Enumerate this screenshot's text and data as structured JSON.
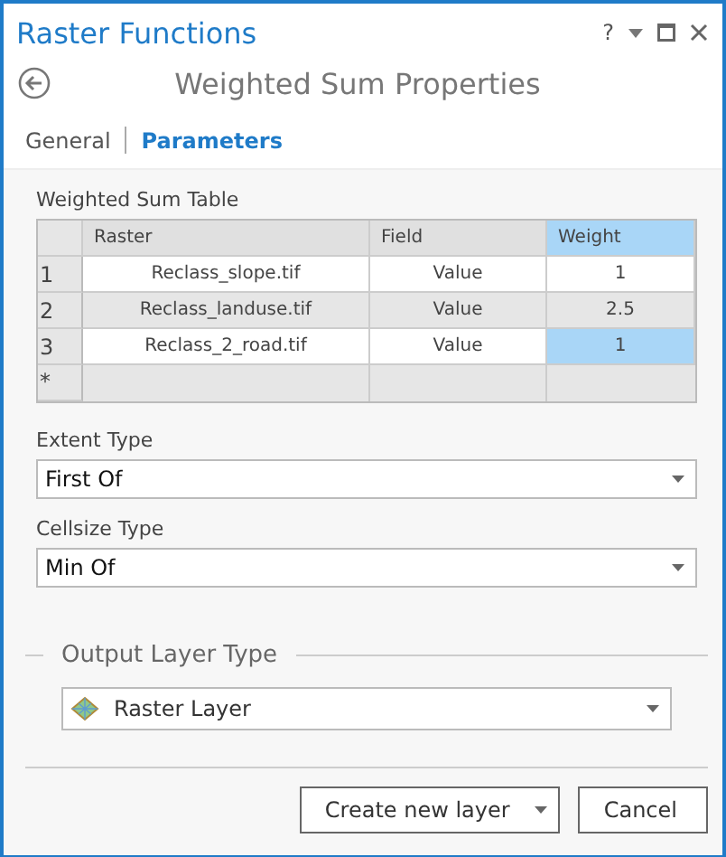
{
  "window": {
    "title": "Raster Functions",
    "help": "?"
  },
  "header": {
    "title": "Weighted Sum Properties"
  },
  "tabs": [
    {
      "label": "General",
      "selected": false
    },
    {
      "label": "Parameters",
      "selected": true
    }
  ],
  "table": {
    "title": "Weighted Sum Table",
    "columns": [
      {
        "label": "Raster",
        "selected": false
      },
      {
        "label": "Field",
        "selected": false
      },
      {
        "label": "Weight",
        "selected": true
      }
    ],
    "rows": [
      {
        "number": "1",
        "raster": "Reclass_slope.tif",
        "field": "Value",
        "weight": "1",
        "selected": false
      },
      {
        "number": "2",
        "raster": "Reclass_landuse.tif",
        "field": "Value",
        "weight": "2.5",
        "selected": false
      },
      {
        "number": "3",
        "raster": "Reclass_2_road.tif",
        "field": "Value",
        "weight": "1",
        "selected": true
      }
    ],
    "new_row_marker": "*"
  },
  "fields": [
    {
      "label": "Extent Type",
      "value": "First Of"
    },
    {
      "label": "Cellsize Type",
      "value": "Min Of"
    }
  ],
  "output": {
    "title": "Output Layer Type",
    "value": "Raster Layer"
  },
  "buttons": [
    {
      "label": "Create new layer",
      "kind": "split"
    },
    {
      "label": "Cancel",
      "kind": "plain"
    }
  ]
}
